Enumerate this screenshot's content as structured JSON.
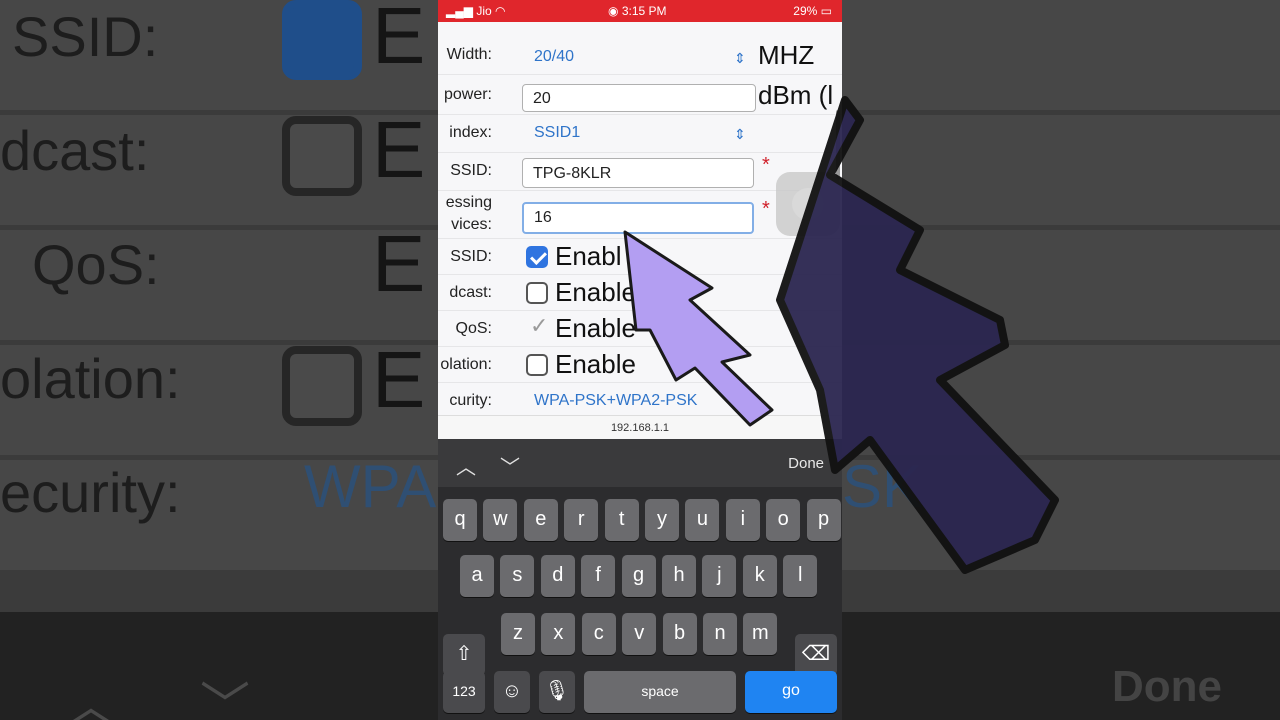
{
  "background": {
    "labels": [
      "SSID:",
      "dcast:",
      "QoS:",
      "olation:",
      "ecurity:"
    ],
    "enable_fragment": "E",
    "security_fragment": "WPA",
    "security_tail": "SK",
    "right_fragments": [
      "MHZ",
      "dBm ("
    ],
    "done": "Done"
  },
  "status_bar": {
    "carrier": "Jio",
    "time": "3:15 PM",
    "battery": "29%"
  },
  "form": {
    "channel_width": {
      "label": "Width:",
      "value": "20/40",
      "unit": "MHZ"
    },
    "tx_power": {
      "label": "power:",
      "value": "20",
      "unit": "dBm (l"
    },
    "ssid_index": {
      "label": "index:",
      "value": "SSID1"
    },
    "ssid": {
      "label": "SSID:",
      "value": "TPG-8KLR",
      "required": "*"
    },
    "max_devices": {
      "label_line1": "essing",
      "label_line2": "vices:",
      "value": "16",
      "required": "*"
    },
    "hide_ssid": {
      "label": "SSID:",
      "text": "Enabl",
      "checked": true
    },
    "broadcast": {
      "label": "dcast:",
      "text": "Enable",
      "checked": false
    },
    "qos": {
      "label": "QoS:",
      "text": "Enable",
      "checked": true
    },
    "isolation": {
      "label": "olation:",
      "text": "Enable",
      "checked": false
    },
    "security": {
      "label": "curity:",
      "value": "WPA-PSK+WPA2-PSK"
    }
  },
  "url": "192.168.1.1",
  "keyboard": {
    "accessory_done": "Done",
    "row1": [
      "q",
      "w",
      "e",
      "r",
      "t",
      "y",
      "u",
      "i",
      "o",
      "p"
    ],
    "row2": [
      "a",
      "s",
      "d",
      "f",
      "g",
      "h",
      "j",
      "k",
      "l"
    ],
    "row3": [
      "z",
      "x",
      "c",
      "v",
      "b",
      "n",
      "m"
    ],
    "numbers_key": "123",
    "space_key": "space",
    "go_key": "go"
  },
  "colors": {
    "status_bar": "#e0262c",
    "accent_blue": "#2f74c9",
    "arrow_fill": "#b39ef2",
    "go_key": "#1f84f2"
  }
}
